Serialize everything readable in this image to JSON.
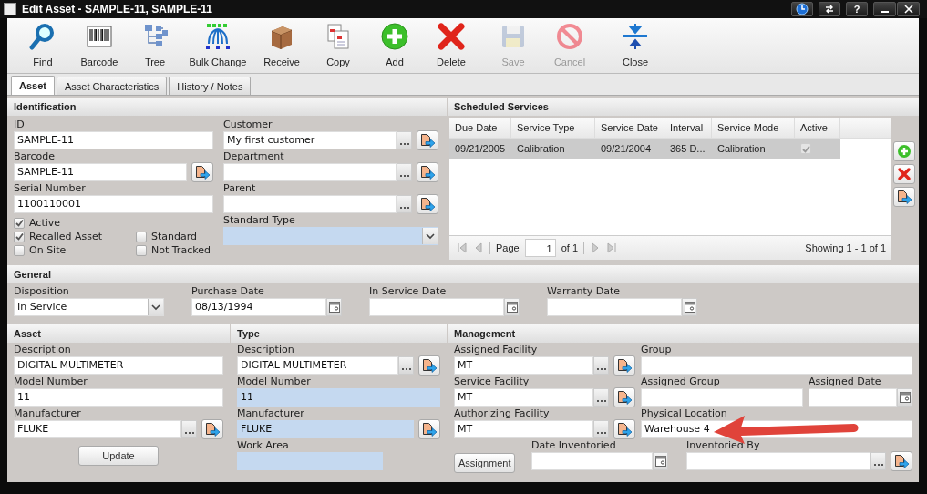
{
  "window": {
    "title": "Edit Asset - SAMPLE-11, SAMPLE-11",
    "help": "?"
  },
  "toolbar": [
    {
      "kind": "find",
      "label": "Find",
      "disabled": false
    },
    {
      "kind": "barcode",
      "label": "Barcode",
      "disabled": false
    },
    {
      "kind": "tree",
      "label": "Tree",
      "disabled": false
    },
    {
      "kind": "bulk",
      "label": "Bulk Change",
      "disabled": false
    },
    {
      "kind": "receive",
      "label": "Receive",
      "disabled": false
    },
    {
      "kind": "copy",
      "label": "Copy",
      "disabled": false
    },
    {
      "kind": "add",
      "label": "Add",
      "disabled": false
    },
    {
      "kind": "delete",
      "label": "Delete",
      "disabled": false
    },
    {
      "kind": "save",
      "label": "Save",
      "disabled": true
    },
    {
      "kind": "cancel",
      "label": "Cancel",
      "disabled": true
    },
    {
      "kind": "close",
      "label": "Close",
      "disabled": false
    }
  ],
  "tabs": [
    {
      "label": "Asset",
      "selected": true
    },
    {
      "label": "Asset Characteristics",
      "selected": false
    },
    {
      "label": "History / Notes",
      "selected": false
    }
  ],
  "identification": {
    "title": "Identification",
    "columns": [
      [
        {
          "label": "ID",
          "value": "SAMPLE-11",
          "kind": "text",
          "readonly": false
        },
        {
          "label": "Barcode",
          "value": "SAMPLE-11",
          "kind": "nav",
          "readonly": false
        },
        {
          "label": "Serial Number",
          "value": "1100110001",
          "kind": "text",
          "readonly": false
        }
      ],
      [
        {
          "label": "Customer",
          "value": "My first customer",
          "kind": "lookup",
          "readonly": false
        },
        {
          "label": "Department",
          "kind": "lookup",
          "readonly": false
        },
        {
          "label": "Parent",
          "kind": "lookup",
          "readonly": false
        },
        {
          "label": "Standard Type",
          "kind": "dropdown",
          "readonly": true
        }
      ]
    ],
    "checkbox_columns": [
      [
        {
          "label": "Active",
          "checked": true
        },
        {
          "label": "Recalled Asset",
          "checked": true
        },
        {
          "label": "On Site",
          "checked": false
        }
      ],
      [
        {
          "label": "Standard",
          "checked": false
        },
        {
          "label": "Not Tracked",
          "checked": false
        }
      ]
    ]
  },
  "scheduled_services": {
    "title": "Scheduled Services",
    "columns": [
      "Due Date",
      "Service Type",
      "Service Date",
      "Interval",
      "Service Mode",
      "Active"
    ],
    "rows": [
      {
        "cells": [
          "09/21/2005",
          "Calibration",
          "09/21/2004",
          "365 D...",
          "Calibration"
        ],
        "active": true,
        "selected": true
      }
    ],
    "pager": {
      "page_label": "Page",
      "page": "1",
      "of": "of 1",
      "showing": "Showing 1 - 1 of 1"
    }
  },
  "general": {
    "title": "General",
    "fields": [
      {
        "label": "Disposition",
        "value": "In Service",
        "kind": "dropdown",
        "readonly": false
      },
      {
        "label": "Purchase Date",
        "value": "08/13/1994",
        "kind": "date",
        "readonly": false
      },
      {
        "label": "In Service Date",
        "kind": "date",
        "readonly": false
      },
      {
        "label": "Warranty Date",
        "kind": "date",
        "readonly": false
      }
    ]
  },
  "asset": {
    "title": "Asset",
    "fields": [
      {
        "label": "Description",
        "value": "DIGITAL MULTIMETER",
        "kind": "text",
        "readonly": false
      },
      {
        "label": "Model Number",
        "value": "11",
        "kind": "text",
        "readonly": false
      },
      {
        "label": "Manufacturer",
        "value": "FLUKE",
        "kind": "lookup",
        "readonly": false
      },
      {
        "label": "Update",
        "kind": "button"
      }
    ]
  },
  "type": {
    "title": "Type",
    "fields": [
      {
        "label": "Description",
        "value": "DIGITAL MULTIMETER",
        "kind": "lookup",
        "readonly": false
      },
      {
        "label": "Model Number",
        "value": "11",
        "kind": "text",
        "readonly": true
      },
      {
        "label": "Manufacturer",
        "value": "FLUKE",
        "kind": "nav",
        "readonly": true
      },
      {
        "label": "Work Area",
        "kind": "text",
        "readonly": true
      }
    ]
  },
  "management": {
    "title": "Management",
    "rows": [
      [
        {
          "label": "Assigned Facility",
          "value": "MT",
          "kind": "lookup",
          "readonly": false
        },
        {
          "label": "Group",
          "kind": "text",
          "readonly": false
        }
      ],
      [
        {
          "label": "Service Facility",
          "value": "MT",
          "kind": "lookup",
          "readonly": false
        },
        {
          "label": "Assigned Group",
          "kind": "text",
          "readonly": false
        },
        {
          "label": "Assigned Date",
          "kind": "date",
          "readonly": false
        }
      ],
      [
        {
          "label": "Authorizing Facility",
          "value": "MT",
          "kind": "lookup",
          "readonly": false
        },
        {
          "label": "Physical Location",
          "value": "Warehouse 4",
          "kind": "text",
          "readonly": false
        }
      ],
      [
        {
          "label": "Assignment",
          "kind": "button"
        },
        {
          "label": "Date Inventoried",
          "kind": "date",
          "readonly": false
        },
        {
          "label": "Inventoried By",
          "kind": "lookup",
          "readonly": false
        }
      ]
    ]
  }
}
